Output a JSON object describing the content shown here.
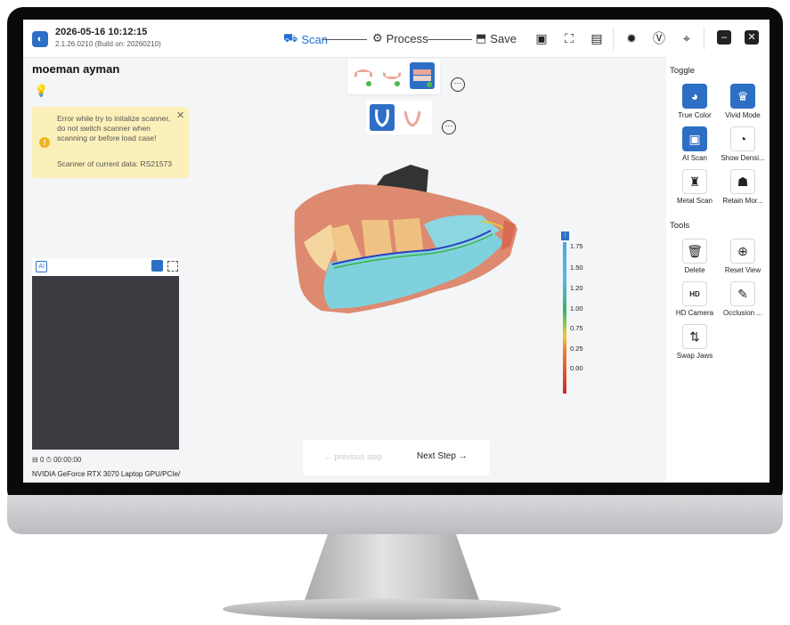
{
  "header": {
    "datetime": "2026-05-16 10:12:15",
    "version": "2.1.26.0210 (Build on: 20260210)",
    "steps": [
      {
        "label": "Scan",
        "icon": "scan-icon",
        "active": true
      },
      {
        "label": "Process",
        "icon": "process-icon",
        "active": false
      },
      {
        "label": "Save",
        "icon": "save-icon",
        "active": false
      }
    ],
    "toolbar_icons": [
      "video-record-icon",
      "screenshot-icon",
      "image-gallery-icon",
      "settings-icon",
      "vip-icon",
      "locate-icon"
    ],
    "window_buttons": [
      "minimize-icon",
      "close-icon"
    ]
  },
  "patient": {
    "name": "moeman ayman"
  },
  "alert": {
    "message": "Error while try to initalize scanner, do not switch scanner when scanning or before load case!",
    "scanner": "Scanner of current data: RS21573"
  },
  "camera": {
    "frames": "0",
    "timer": "00:00:00",
    "gpu": "NVIDIA GeForce RTX 3070 Laptop GPU/PCIe/SSE2"
  },
  "deviation_scale": {
    "labels": [
      "1.75",
      "1.50",
      "1.20",
      "1.00",
      "0.75",
      "0.25",
      "0.00"
    ]
  },
  "navigation": {
    "previous": "previous step",
    "next": "Next Step"
  },
  "toggle": {
    "title": "Toggle",
    "items": [
      {
        "label": "True Color",
        "icon": "color-wheel-icon",
        "active": true
      },
      {
        "label": "Vivid Mode",
        "icon": "tooth-icon",
        "active": true
      },
      {
        "label": "AI Scan",
        "icon": "ai-chip-icon",
        "active": true
      },
      {
        "label": "Show Densi...",
        "icon": "density-icon",
        "active": false
      },
      {
        "label": "Metal Scan",
        "icon": "metal-scan-icon",
        "active": false
      },
      {
        "label": "Retain Mor...",
        "icon": "retain-icon",
        "active": false
      }
    ]
  },
  "tools": {
    "title": "Tools",
    "items": [
      {
        "label": "Delete",
        "icon": "trash-icon"
      },
      {
        "label": "Reset View",
        "icon": "zoom-reset-icon"
      },
      {
        "label": "HD Camera",
        "icon": "hd-camera-icon"
      },
      {
        "label": "Occlusion ...",
        "icon": "occlusion-icon"
      },
      {
        "label": "Swap Jaws",
        "icon": "swap-jaws-icon"
      }
    ]
  },
  "colors": {
    "accent": "#2d6fc4",
    "alert_bg": "#fbf0b9",
    "warning": "#f1b31c"
  }
}
